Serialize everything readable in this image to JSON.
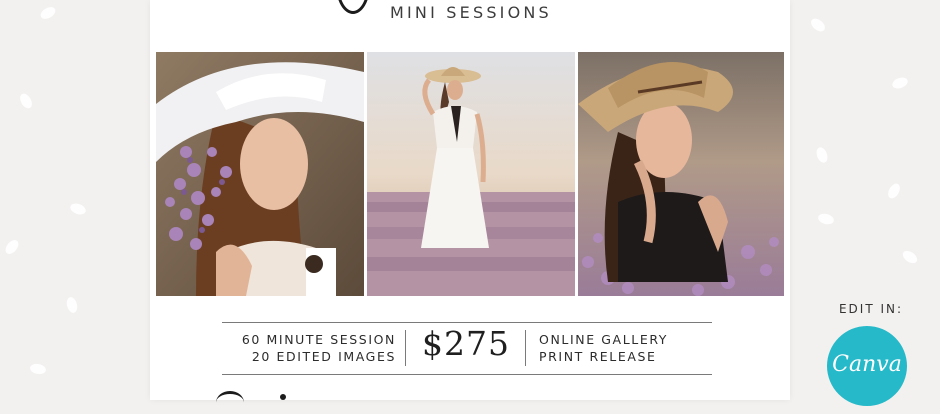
{
  "card": {
    "subtitle": "MINI SESSIONS"
  },
  "details": {
    "left_line1": "60 MINUTE SESSION",
    "left_line2": "20 EDITED IMAGES",
    "price": "$275",
    "right_line1": "ONLINE GALLERY",
    "right_line2": "PRINT RELEASE"
  },
  "badge": {
    "edit_in_label": "EDIT IN:",
    "canva_label": "Canva"
  },
  "photos": [
    {
      "id": "photo-closeup-lavender-hat",
      "description_icon": "woman-portrait-image"
    },
    {
      "id": "photo-white-dress-field",
      "description_icon": "woman-full-length-image"
    },
    {
      "id": "photo-hat-black-top",
      "description_icon": "woman-portrait-image"
    }
  ],
  "colors": {
    "background": "#f3f1ef",
    "card": "#ffffff",
    "canva_teal": "#25b9c9",
    "lavender": "#a984b8"
  }
}
